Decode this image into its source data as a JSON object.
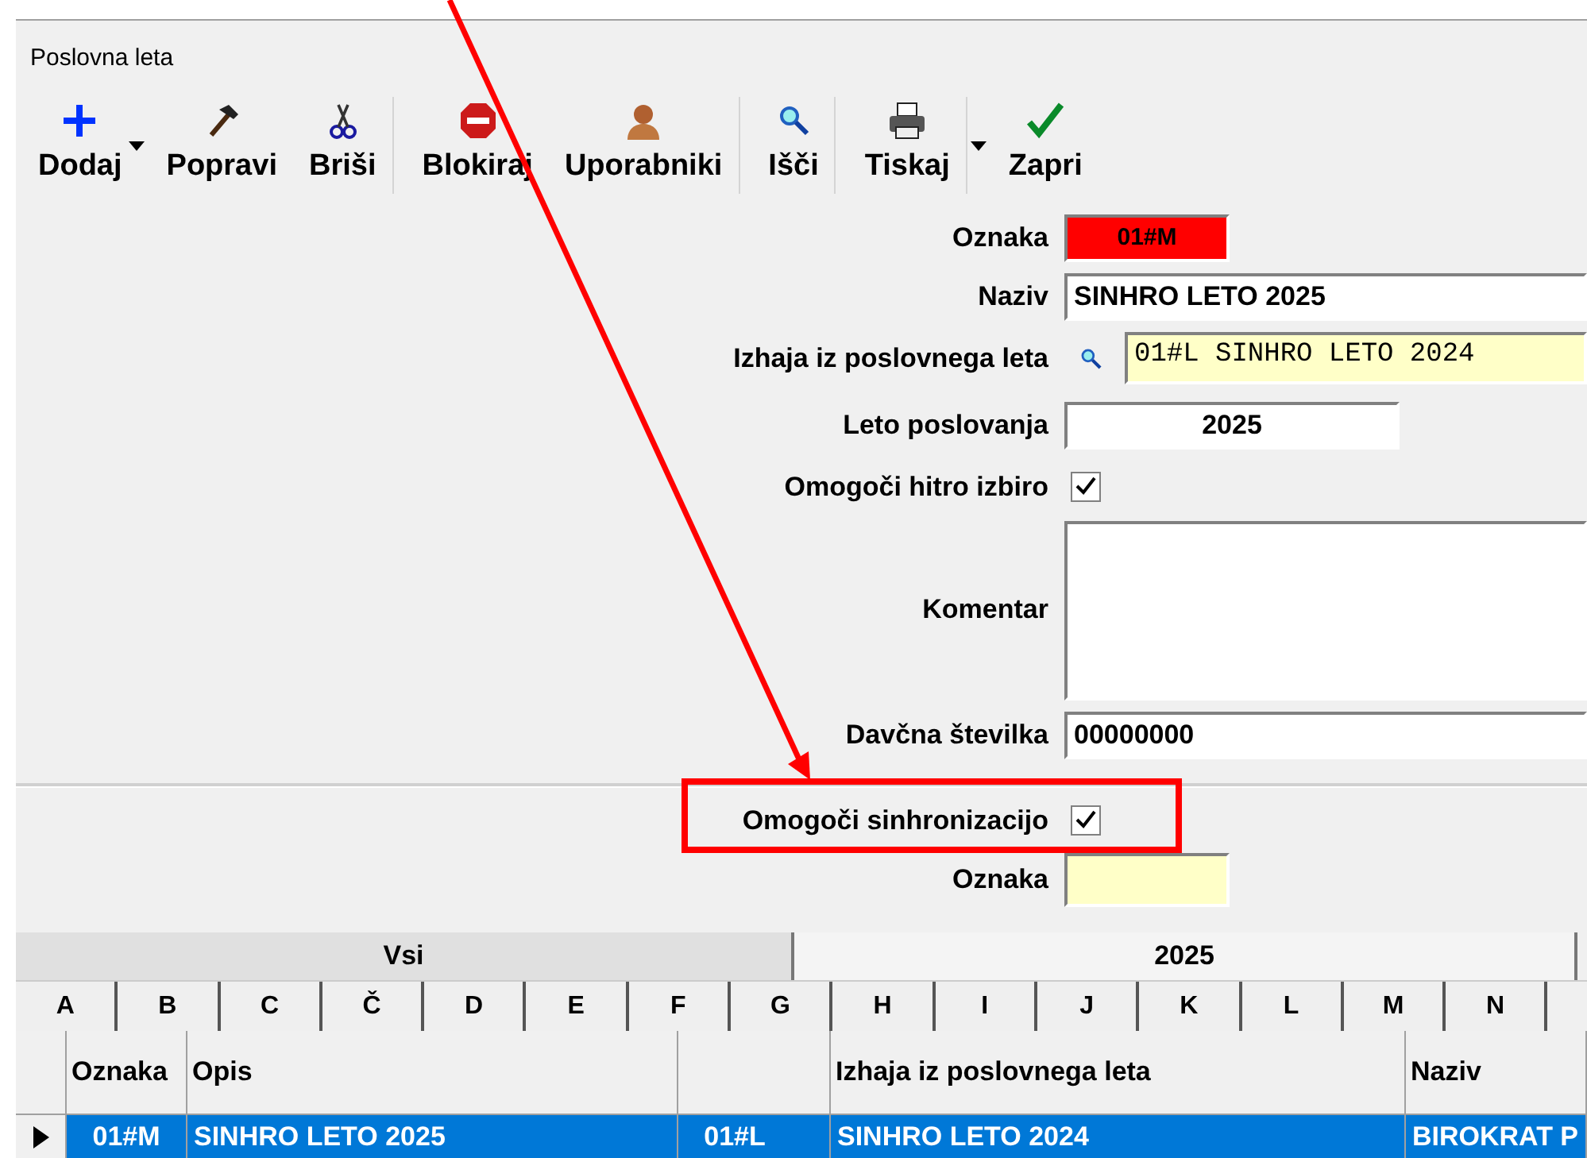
{
  "window": {
    "title": "Poslovna leta"
  },
  "toolbar": [
    {
      "label": "Dodaj",
      "kind": "plus",
      "dropdown": true,
      "separator_after": false
    },
    {
      "label": "Popravi",
      "kind": "hammer",
      "dropdown": false,
      "separator_after": false
    },
    {
      "label": "Briši",
      "kind": "scissors",
      "dropdown": false,
      "separator_after": true
    },
    {
      "label": "Blokiraj",
      "kind": "stop",
      "dropdown": false,
      "separator_after": false
    },
    {
      "label": "Uporabniki",
      "kind": "user",
      "dropdown": false,
      "separator_after": true
    },
    {
      "label": "Išči",
      "kind": "search",
      "dropdown": false,
      "separator_after": true
    },
    {
      "label": "Tiskaj",
      "kind": "printer",
      "dropdown": true,
      "separator_after": true
    },
    {
      "label": "Zapri",
      "kind": "check",
      "dropdown": false,
      "separator_after": false
    }
  ],
  "form": [
    {
      "label": "Oznaka",
      "kind": "code",
      "value": "01#M"
    },
    {
      "label": "Naziv",
      "kind": "text",
      "value": "SINHRO LETO 2025"
    },
    {
      "label": "Izhaja iz poslovnega leta",
      "kind": "lookup",
      "value": "01#L SINHRO LETO 2024"
    },
    {
      "label": "Leto poslovanja",
      "kind": "year",
      "value": "2025"
    },
    {
      "label": "Omogoči hitro izbiro",
      "kind": "checkbox",
      "checked": true
    },
    {
      "label": "Komentar",
      "kind": "memo"
    },
    {
      "label": "Davčna številka",
      "kind": "text",
      "value": "00000000"
    }
  ],
  "sync": [
    {
      "label": "Omogoči sinhronizacijo",
      "kind": "checkbox",
      "checked": true
    },
    {
      "label": "Oznaka",
      "kind": "short"
    }
  ],
  "tabs": [
    {
      "label": "Vsi",
      "selected": false
    },
    {
      "label": "2025",
      "selected": true
    }
  ],
  "letters": [
    "A",
    "B",
    "C",
    "Č",
    "D",
    "E",
    "F",
    "G",
    "H",
    "I",
    "J",
    "K",
    "L",
    "M",
    "N"
  ],
  "table": {
    "columns": [
      {
        "kind": "text",
        "label": "Oznaka"
      },
      {
        "kind": "text",
        "label": "Opis"
      },
      {
        "kind": "blank"
      },
      {
        "kind": "text",
        "label": "Izhaja iz poslovnega leta"
      },
      {
        "kind": "text",
        "label": "Naziv"
      }
    ],
    "rows": [
      {
        "selected": true,
        "cells": [
          "01#M",
          "SINHRO LETO 2025",
          "01#L",
          "SINHRO LETO 2024",
          "BIROKRAT P"
        ]
      }
    ]
  }
}
